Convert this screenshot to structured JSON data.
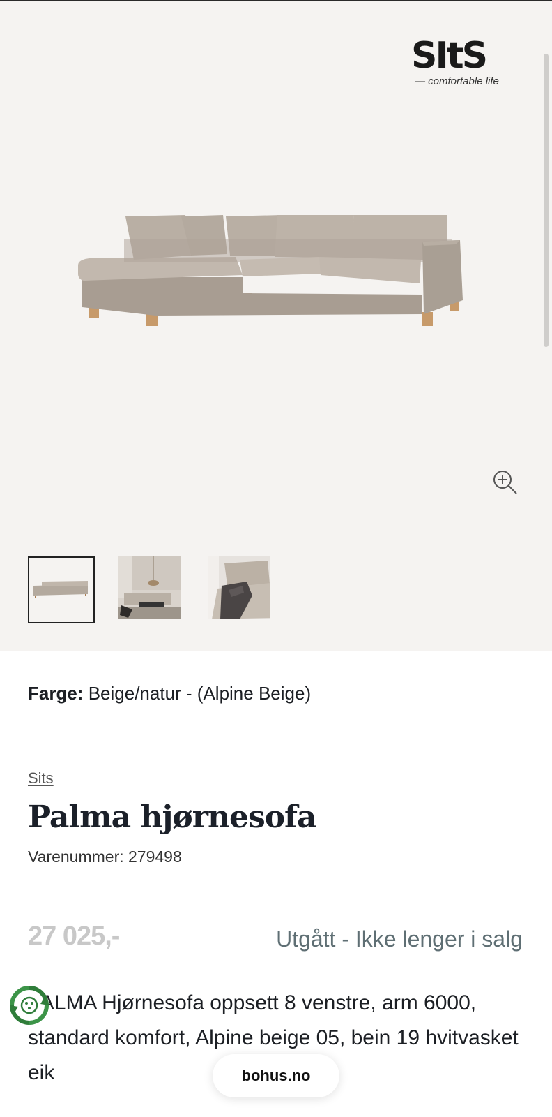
{
  "gallery": {
    "brand_logo": {
      "word": "SItS",
      "tagline": "— comfortable life"
    },
    "zoom_icon": "zoom-in-icon",
    "thumbnails": [
      {
        "label": "sofa-studio",
        "selected": true
      },
      {
        "label": "sofa-livingroom",
        "selected": false
      },
      {
        "label": "sofa-closeup",
        "selected": false
      }
    ]
  },
  "product": {
    "color_label": "Farge:",
    "color_value": "Beige/natur - (Alpine Beige)",
    "brand": "Sits",
    "title": "Palma hjørnesofa",
    "sku_text": "Varenummer: 279498",
    "price": "27 025,-",
    "status": "Utgått - Ikke lenger i salg",
    "description": "PALMA Hjørnesofa oppsett 8 venstre, arm 6000, standard komfort, Alpine beige 05, bein 19 hvitvasket eik"
  },
  "footer": {
    "domain_pill": "bohus.no",
    "eco_badge_icon": "recycle-badge-icon"
  },
  "colors": {
    "gallery_bg": "#f5f3f1",
    "status_text": "#5f6f74",
    "price_text": "#c8c8c8",
    "eco_green": "#2f7d3a"
  }
}
